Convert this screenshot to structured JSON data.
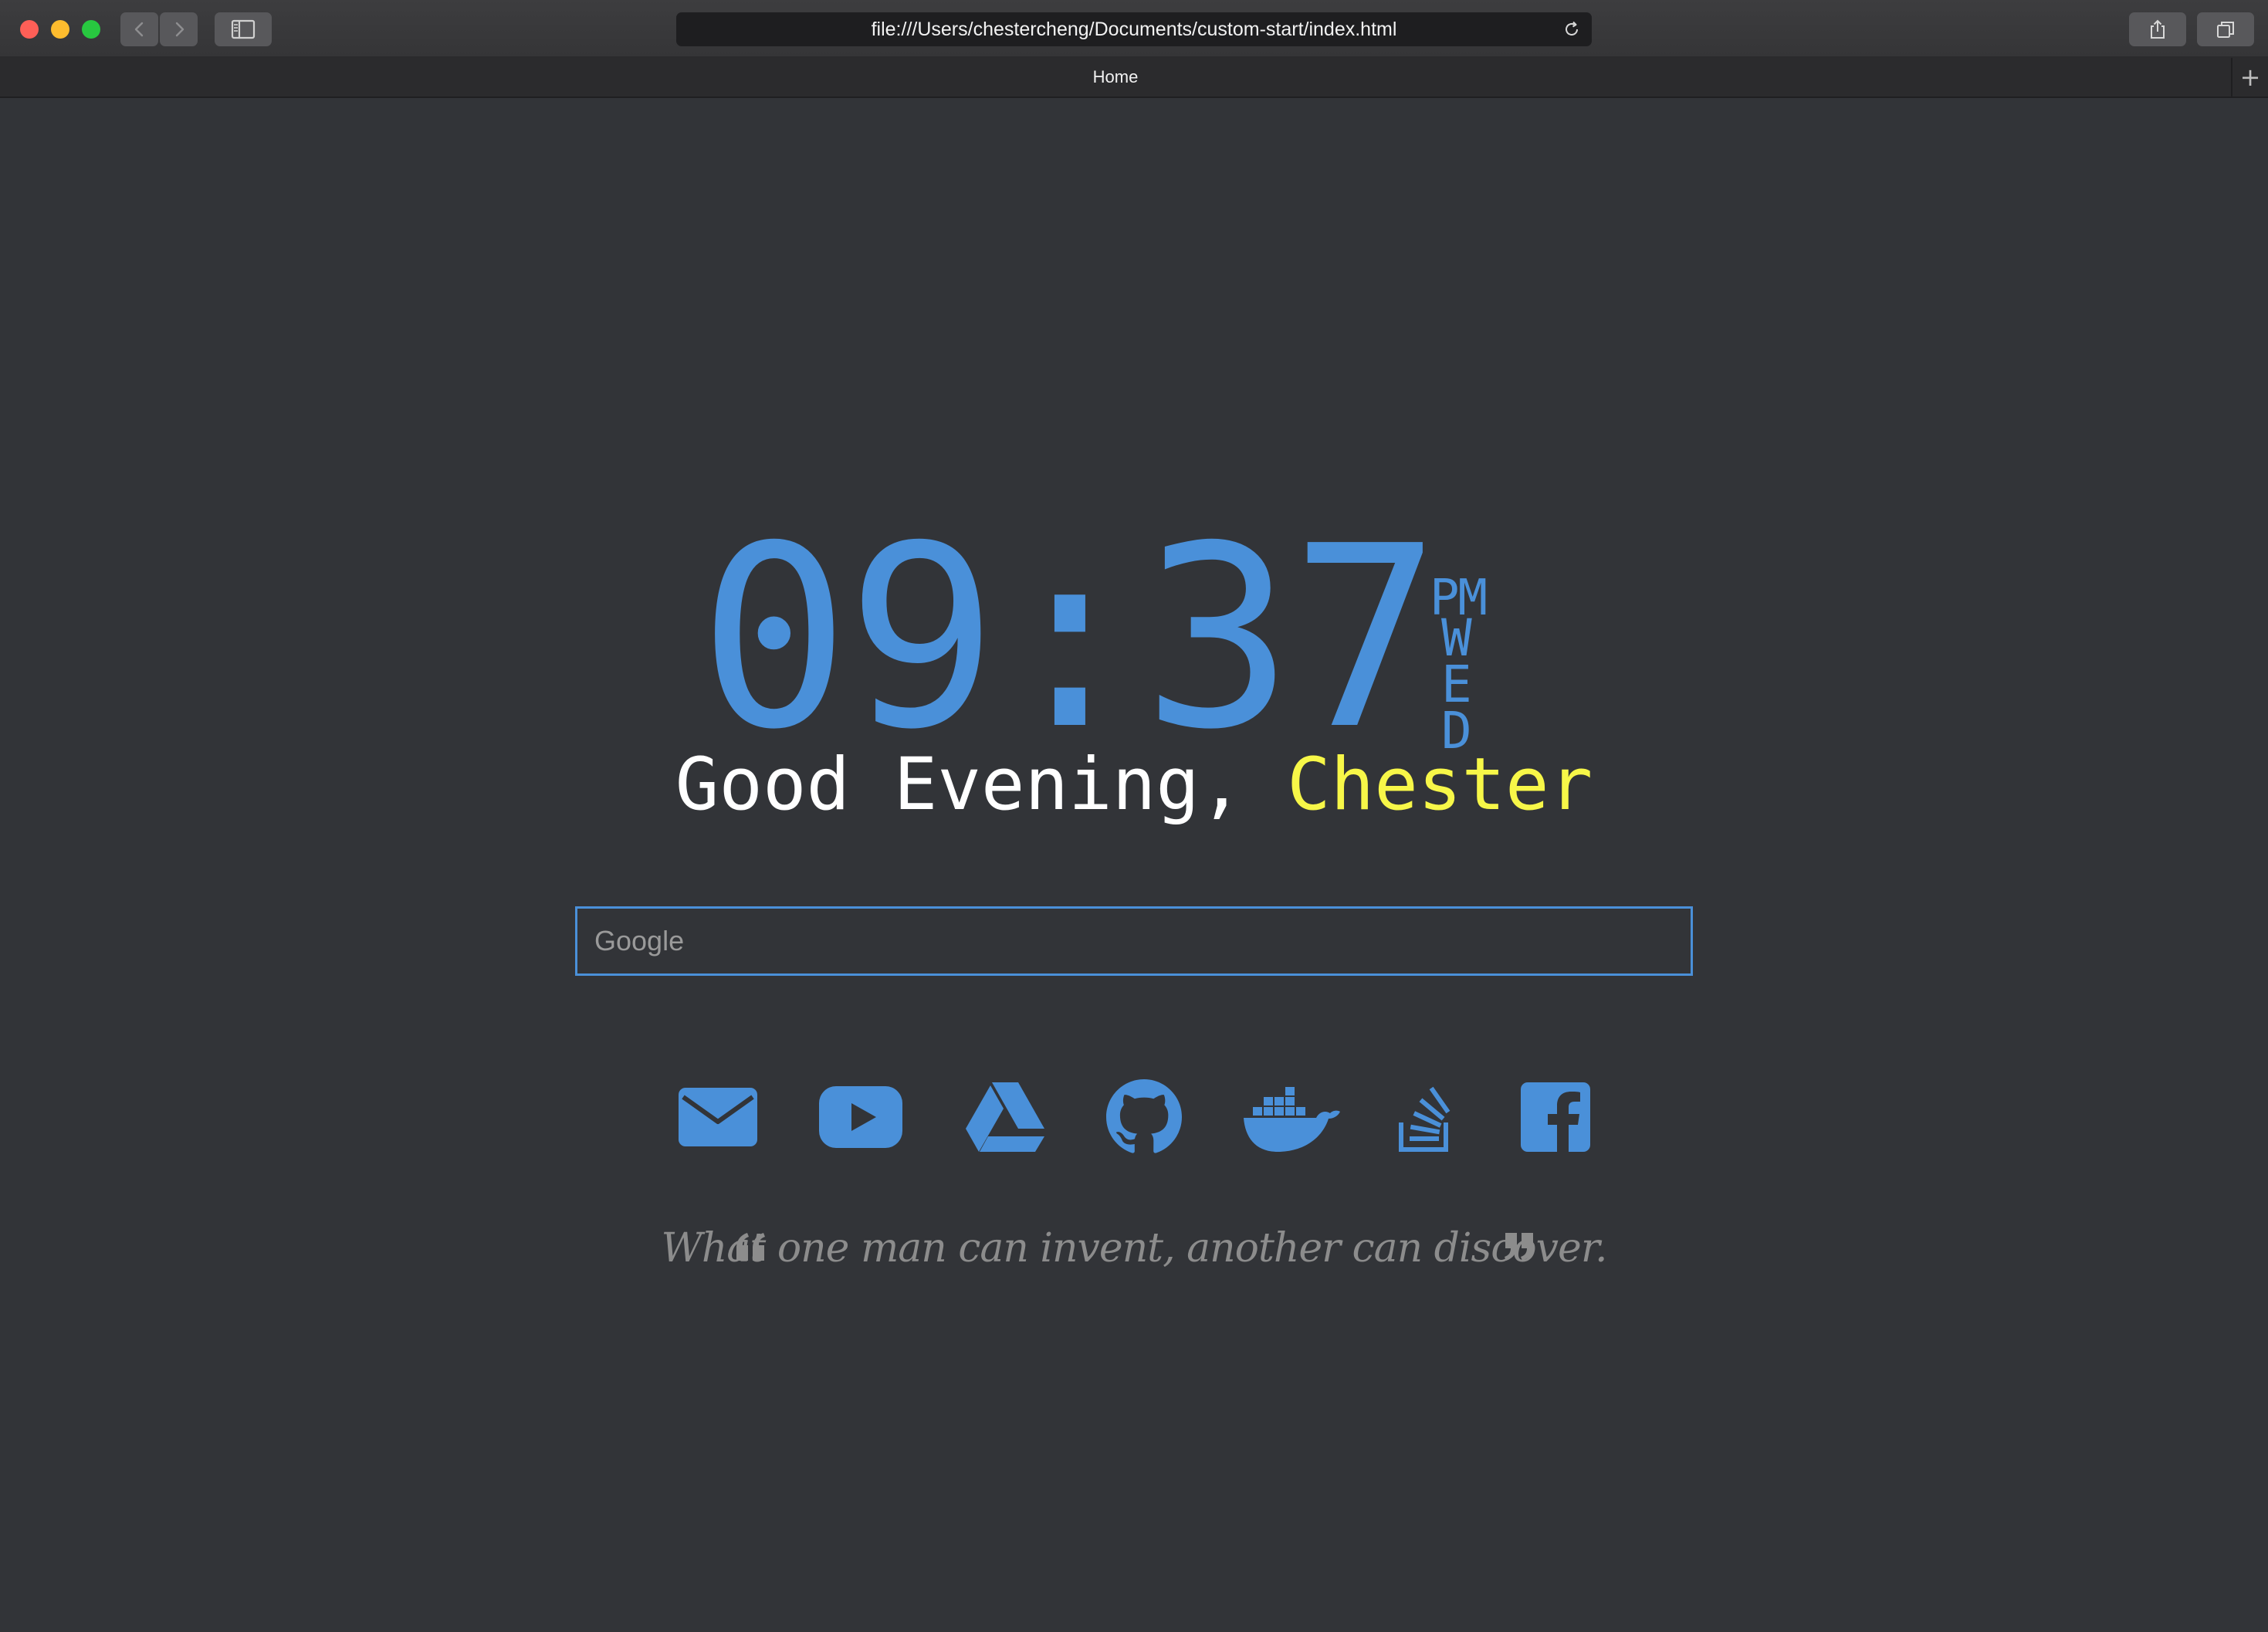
{
  "browser": {
    "url": "file:///Users/chestercheng/Documents/custom-start/index.html",
    "tab_title": "Home",
    "new_tab_label": "+"
  },
  "clock": {
    "time": "09:37",
    "ampm": "PM",
    "day": "WED"
  },
  "greeting": {
    "salutation": "Good Evening,",
    "name": "Chester"
  },
  "search": {
    "placeholder": "Google"
  },
  "links": [
    {
      "icon": "mail-icon"
    },
    {
      "icon": "youtube-icon"
    },
    {
      "icon": "google-drive-icon"
    },
    {
      "icon": "github-icon"
    },
    {
      "icon": "docker-icon"
    },
    {
      "icon": "stackoverflow-icon"
    },
    {
      "icon": "facebook-icon"
    }
  ],
  "quote": {
    "text": "What one man can invent, another can discover."
  },
  "colors": {
    "background": "#323438",
    "accent": "#4a90d9",
    "name_highlight": "#f7f748",
    "greeting_text": "#ffffff",
    "quote_text": "#8c8c8c"
  }
}
